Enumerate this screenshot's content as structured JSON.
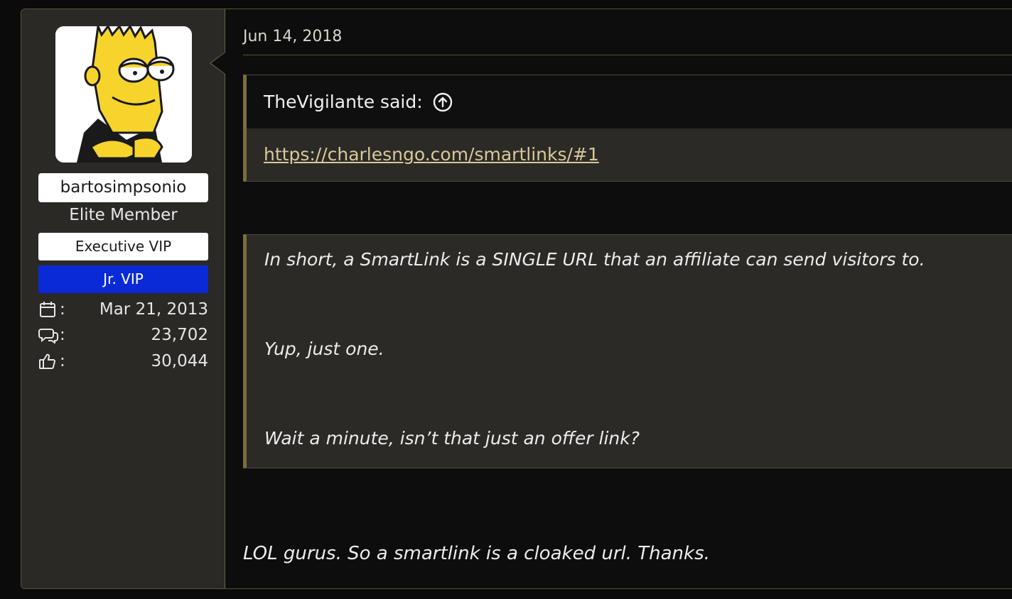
{
  "user": {
    "username": "bartosimpsonio",
    "title": "Elite Member",
    "banners": [
      "Executive VIP",
      "Jr. VIP"
    ],
    "stats": [
      {
        "icon": "calendar-icon",
        "value": "Mar 21, 2013"
      },
      {
        "icon": "messages-icon",
        "value": "23,702"
      },
      {
        "icon": "thumbs-up-icon",
        "value": "30,044"
      }
    ],
    "stat_separator": ":"
  },
  "post": {
    "date": "Jun 14, 2018",
    "quote": {
      "author_said": "TheVigilante said:",
      "link_text": "https://charlesngo.com/smartlinks/#1"
    },
    "excerpt_lines": [
      "In short, a SmartLink is a SINGLE URL that an affiliate can send visitors to.",
      "Yup, just one.",
      "Wait a minute, isn’t that just an offer link?"
    ],
    "reply": "LOL gurus. So a smartlink is a cloaked url. Thanks."
  },
  "colors": {
    "page_bg": "#0b0b0b",
    "sidebar_bg": "#2a2926",
    "accent_gold": "#7c6e3c",
    "jr_vip_banner": "#0a2ad8",
    "link": "#d9c89a"
  }
}
